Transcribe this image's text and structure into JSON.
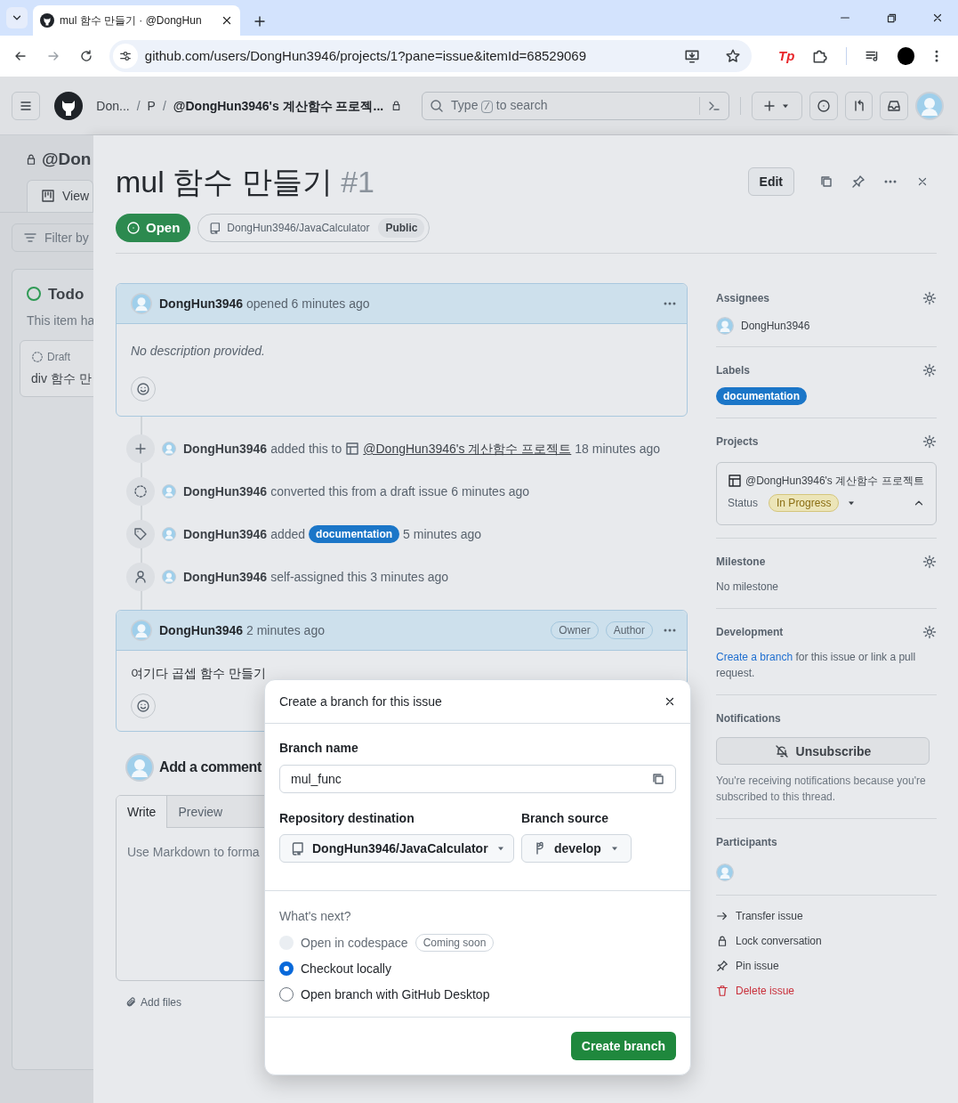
{
  "browser": {
    "tab_title": "mul 함수 만들기 · @DongHun",
    "url": "github.com/users/DongHun3946/projects/1?pane=issue&itemId=68529069",
    "extension_badge": "Tp"
  },
  "header": {
    "breadcrumbs": [
      "Don...",
      "P",
      "@DongHun3946's 계산함수 프로젝..."
    ],
    "separators": [
      "/",
      "/"
    ],
    "search": {
      "prefix": "Type",
      "key": "/",
      "suffix": "to search"
    }
  },
  "board": {
    "title": "@Don",
    "view_tab": "View",
    "filter": "Filter by",
    "column": "Todo",
    "column_note": "This item ha",
    "card_state": "Draft",
    "card_title": "div 함수 만"
  },
  "issue": {
    "title": "mul 함수 만들기",
    "number": "#1",
    "state": "Open",
    "repo": "DongHun3946/JavaCalculator",
    "visibility": "Public",
    "edit_button": "Edit"
  },
  "opening_comment": {
    "author": "DongHun3946",
    "meta": "opened 6 minutes ago",
    "body": "No description provided."
  },
  "events": [
    {
      "kind": "project",
      "author": "DongHun3946",
      "action": "added this to",
      "target": "@DongHun3946's 계산함수 프로젝트",
      "time": "18 minutes ago"
    },
    {
      "kind": "converted",
      "author": "DongHun3946",
      "action": "converted this from a draft issue 6 minutes ago"
    },
    {
      "kind": "label",
      "author": "DongHun3946",
      "action": "added",
      "target": "documentation",
      "time": "5 minutes ago"
    },
    {
      "kind": "assigned",
      "author": "DongHun3946",
      "action": "self-assigned this 3 minutes ago"
    }
  ],
  "comment": {
    "author": "DongHun3946",
    "meta": "2 minutes ago",
    "badges": [
      "Owner",
      "Author"
    ],
    "body": "여기다 곱셉 함수 만들기"
  },
  "composer": {
    "heading": "Add a comment",
    "tabs": [
      {
        "label": "Write",
        "selected": true
      },
      {
        "label": "Preview",
        "selected": false
      }
    ],
    "placeholder": "Use Markdown to forma",
    "add_files": "Add files"
  },
  "sidebar": {
    "assignees": {
      "heading": "Assignees",
      "people": [
        "DongHun3946"
      ]
    },
    "labels": {
      "heading": "Labels",
      "items": [
        "documentation"
      ]
    },
    "projects": {
      "heading": "Projects",
      "name": "@DongHun3946's 계산함수 프로젝트",
      "field": "Status",
      "value": "In Progress"
    },
    "milestone": {
      "heading": "Milestone",
      "value": "No milestone"
    },
    "development": {
      "heading": "Development",
      "link": "Create a branch",
      "text": "for this issue or link a pull request."
    },
    "notifications": {
      "heading": "Notifications",
      "button": "Unsubscribe",
      "note": "You're receiving notifications because you're subscribed to this thread."
    },
    "participants": {
      "heading": "Participants"
    },
    "actions": [
      {
        "kind": "transfer",
        "label": "Transfer issue"
      },
      {
        "kind": "lock",
        "label": "Lock conversation"
      },
      {
        "kind": "pin",
        "label": "Pin issue"
      },
      {
        "kind": "delete",
        "label": "Delete issue"
      }
    ]
  },
  "dialog": {
    "title": "Create a branch for this issue",
    "branch_label": "Branch name",
    "branch_value": "mul_func",
    "repo_label": "Repository destination",
    "repo": "DongHun3946/JavaCalculator",
    "source_label": "Branch source",
    "source": "develop",
    "next_label": "What's next?",
    "options": [
      {
        "label": "Open in codespace",
        "badge": "Coming soon",
        "disabled": true,
        "selected": false
      },
      {
        "label": "Checkout locally",
        "disabled": false,
        "selected": true
      },
      {
        "label": "Open branch with GitHub Desktop",
        "disabled": false,
        "selected": false
      }
    ],
    "submit": "Create branch"
  }
}
